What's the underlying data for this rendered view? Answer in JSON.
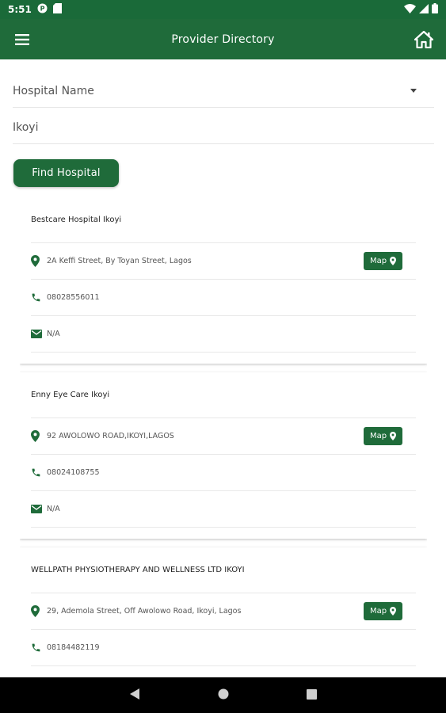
{
  "status_bar": {
    "time": "5:51"
  },
  "app_bar": {
    "title": "Provider Directory",
    "menu_icon": "menu-icon",
    "home_icon": "home-icon"
  },
  "search": {
    "hospital_field": "Hospital Name",
    "location_field": "Ikoyi",
    "find_button": "Find Hospital"
  },
  "map_label": "Map",
  "hospitals": [
    {
      "name": "Bestcare Hospital Ikoyi",
      "address": "2A Keffi Street, By Toyan Street, Lagos",
      "phone": "08028556011",
      "email": "N/A"
    },
    {
      "name": "Enny Eye Care Ikoyi",
      "address": "92 AWOLOWO ROAD,IKOYI,LAGOS",
      "phone": "08024108755",
      "email": "N/A"
    },
    {
      "name": "WELLPATH PHYSIOTHERAPY AND WELLNESS LTD IKOYI",
      "address": "29, Ademola Street, Off Awolowo Road, Ikoyi, Lagos",
      "phone": "08184482119",
      "email": ""
    }
  ],
  "colors": {
    "primary": "#1f6b3a",
    "status_bar": "#1a6a39"
  }
}
